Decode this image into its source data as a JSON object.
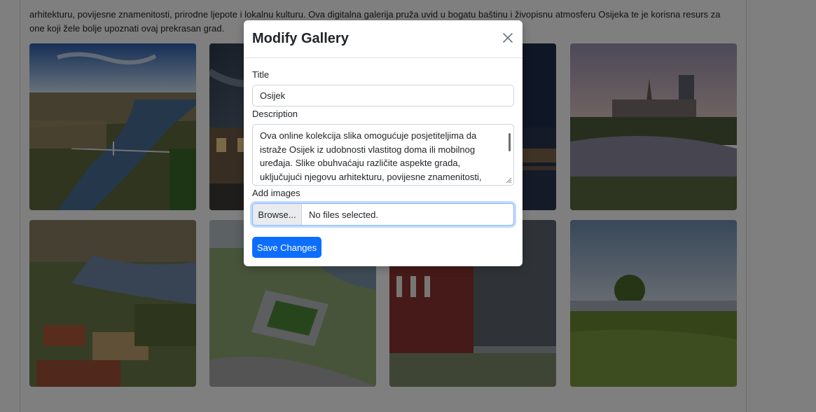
{
  "page": {
    "intro_text": "arhitekturu, povijesne znamenitosti, prirodne ljepote i lokalnu kulturu. Ova digitalna galerija pruža uvid u bogatu baštinu i živopisnu atmosferu Osijeka te je korisna resurs za one koji žele bolje upoznati ovaj prekrasan grad."
  },
  "gallery": {
    "images": [
      {
        "subject": "aerial-river-bridge"
      },
      {
        "subject": "city-street-dusk"
      },
      {
        "subject": "river-night"
      },
      {
        "subject": "riverbank-cathedral"
      },
      {
        "subject": "aerial-fortress"
      },
      {
        "subject": "stadium-render"
      },
      {
        "subject": "modern-building"
      },
      {
        "subject": "riverside-meadow"
      }
    ]
  },
  "modal": {
    "title": "Modify Gallery",
    "close_icon": "close-icon",
    "title_label": "Title",
    "title_value": "Osijek",
    "description_label": "Description",
    "description_value": "Ova online kolekcija slika omogućuje posjetiteljima da istraže Osijek iz udobnosti vlastitog doma ili mobilnog uređaja. Slike obuhvaćaju različite aspekte grada, uključujući njegovu arhitekturu, povijesne znamenitosti, prirodne ljepote i lokalnu",
    "add_images_label": "Add images",
    "browse_label": "Browse...",
    "file_status": "No files selected.",
    "save_label": "Save Changes"
  },
  "colors": {
    "primary": "#0d6efd",
    "backdrop": "rgba(0,0,0,0.5)",
    "focus_border": "#86b7fe"
  }
}
